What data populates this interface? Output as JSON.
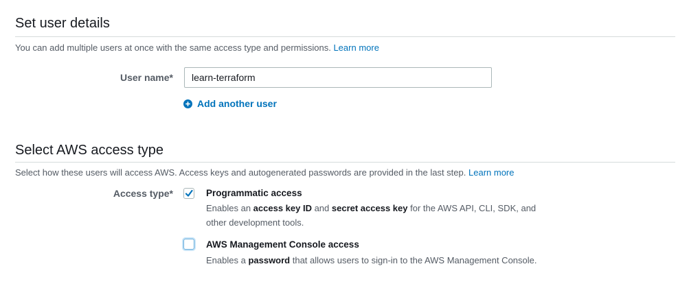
{
  "user_details": {
    "title": "Set user details",
    "description": "You can add multiple users at once with the same access type and permissions.",
    "learn_more": "Learn more",
    "user_name_label": "User name*",
    "user_name_value": "learn-terraform",
    "add_another_user": "Add another user"
  },
  "access_type": {
    "title": "Select AWS access type",
    "description": "Select how these users will access AWS. Access keys and autogenerated passwords are provided in the last step.",
    "learn_more": "Learn more",
    "label": "Access type*",
    "options": [
      {
        "title": "Programmatic access",
        "checked": true,
        "desc_parts": [
          "Enables an ",
          "access key ID",
          " and ",
          "secret access key",
          " for the AWS API, CLI, SDK, and",
          "other development tools."
        ]
      },
      {
        "title": "AWS Management Console access",
        "checked": false,
        "desc_parts": [
          "Enables a ",
          "password",
          " that allows users to sign-in to the AWS Management Console."
        ]
      }
    ]
  },
  "colors": {
    "link": "#0073bb",
    "checkbox_check": "#0073bb",
    "divider": "#d5dbdb"
  },
  "icons": {
    "add_user": "plus-circle-icon",
    "check": "checkmark-icon"
  }
}
